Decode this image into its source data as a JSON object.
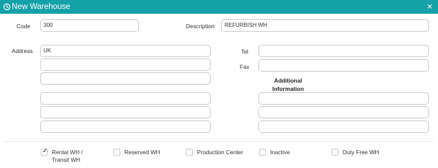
{
  "dialog": {
    "title": "New Warehouse",
    "close_symbol": "×",
    "title_icon": "refresh-icon",
    "accent_color": "#14a1a8"
  },
  "form": {
    "code_label": "Code",
    "code_value": "300",
    "description_label": "Description",
    "description_value": "REFURBISH WH",
    "address_label": "Address",
    "address_lines": [
      "UK",
      "",
      "",
      "",
      "",
      ""
    ],
    "tel_label": "Tel",
    "tel_value": "",
    "fax_label": "Fax",
    "fax_value": "",
    "additional_info_label": "Additional Information",
    "additional_info_lines": [
      "",
      "",
      ""
    ]
  },
  "options": [
    {
      "label": "Rental WH / Transit WH",
      "checked": true
    },
    {
      "label": "Reserved WH",
      "checked": false
    },
    {
      "label": "Production Center",
      "checked": false
    },
    {
      "label": "Inactive",
      "checked": false
    },
    {
      "label": "Duty Free WH",
      "checked": false
    }
  ]
}
